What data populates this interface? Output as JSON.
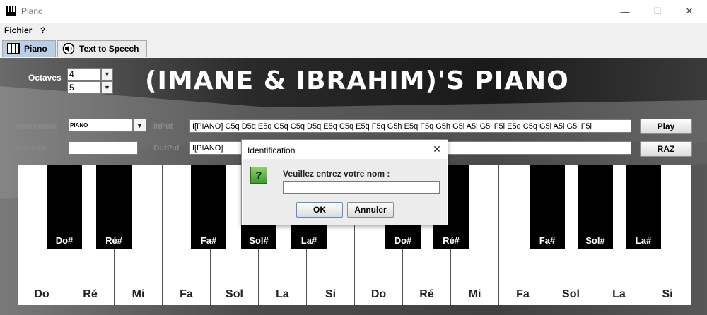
{
  "window": {
    "title": "Piano",
    "minimize": "—",
    "maximize": "☐",
    "close": "✕"
  },
  "menu": [
    {
      "label": "Fichier"
    },
    {
      "label": "?"
    }
  ],
  "tabs": [
    {
      "label": "Piano"
    },
    {
      "label": "Text to Speech"
    }
  ],
  "heading": "(IMANE & IBRAHIM)'S PIANO",
  "octaves": {
    "label": "Octaves",
    "first": "4",
    "second": "5"
  },
  "instrument": {
    "label": "Instrument",
    "value": "PIANO"
  },
  "console": {
    "label": "Console",
    "value": ""
  },
  "input": {
    "label": "InPut",
    "value": "I[PIANO] C5q D5q E5q C5q C5q D5q E5q C5q E5q F5q G5h E5q F5q G5h G5i A5i G5i F5i E5q C5q G5i A5i G5i F5i"
  },
  "output": {
    "label": "OutPut",
    "value": "I[PIANO]"
  },
  "buttons": {
    "play": "Play",
    "raz": "RAZ"
  },
  "white_keys": [
    "Do",
    "Ré",
    "Mi",
    "Fa",
    "Sol",
    "La",
    "Si",
    "Do",
    "Ré",
    "Mi",
    "Fa",
    "Sol",
    "La",
    "Si"
  ],
  "black_keys": [
    "Do#",
    "Ré#",
    "Fa#",
    "Sol#",
    "La#",
    "Do#",
    "Ré#",
    "Fa#",
    "Sol#",
    "La#"
  ],
  "dialog": {
    "title": "Identification",
    "message": "Veuillez entrez votre nom :",
    "input_value": "",
    "ok": "OK",
    "cancel": "Annuler",
    "close": "✕",
    "icon_glyph": "?"
  },
  "colors": {
    "tab_selected": "#b8cfe5",
    "panel_bg": "#000000",
    "dialog_icon": "#5cb83f"
  }
}
